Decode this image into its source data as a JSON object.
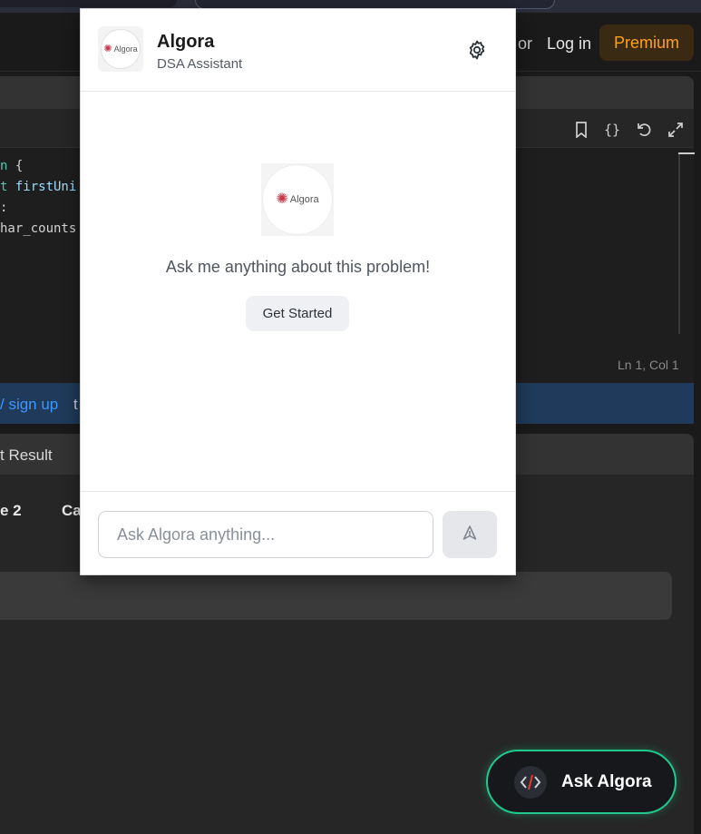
{
  "topbar": {
    "or_text": "or",
    "login_label": "Log in",
    "premium_label": "Premium"
  },
  "editor": {
    "code_lines": [
      {
        "a": "n ",
        "b": "{"
      },
      {
        "a": "t ",
        "b": "firstUni"
      },
      {
        "a": "",
        "b": ":"
      },
      {
        "a": "",
        "b": "har_counts"
      }
    ],
    "cursor_position": "Ln 1, Col 1"
  },
  "signup_banner": {
    "link_text": "/ sign up",
    "rest_text": "t"
  },
  "result": {
    "tab_label": "t Result",
    "case_2_label": "e 2",
    "case_3_label": "Ca"
  },
  "popup": {
    "app_name": "Algora",
    "app_subtitle": "DSA Assistant",
    "logo_text": "Algora",
    "empty_message": "Ask me anything about this problem!",
    "get_started_label": "Get Started",
    "input_placeholder": "Ask Algora anything..."
  },
  "ask_button": {
    "label": "Ask Algora"
  },
  "colors": {
    "accent_green": "#20c98b",
    "premium_orange": "#ffa116",
    "link_blue": "#3c97ff"
  }
}
